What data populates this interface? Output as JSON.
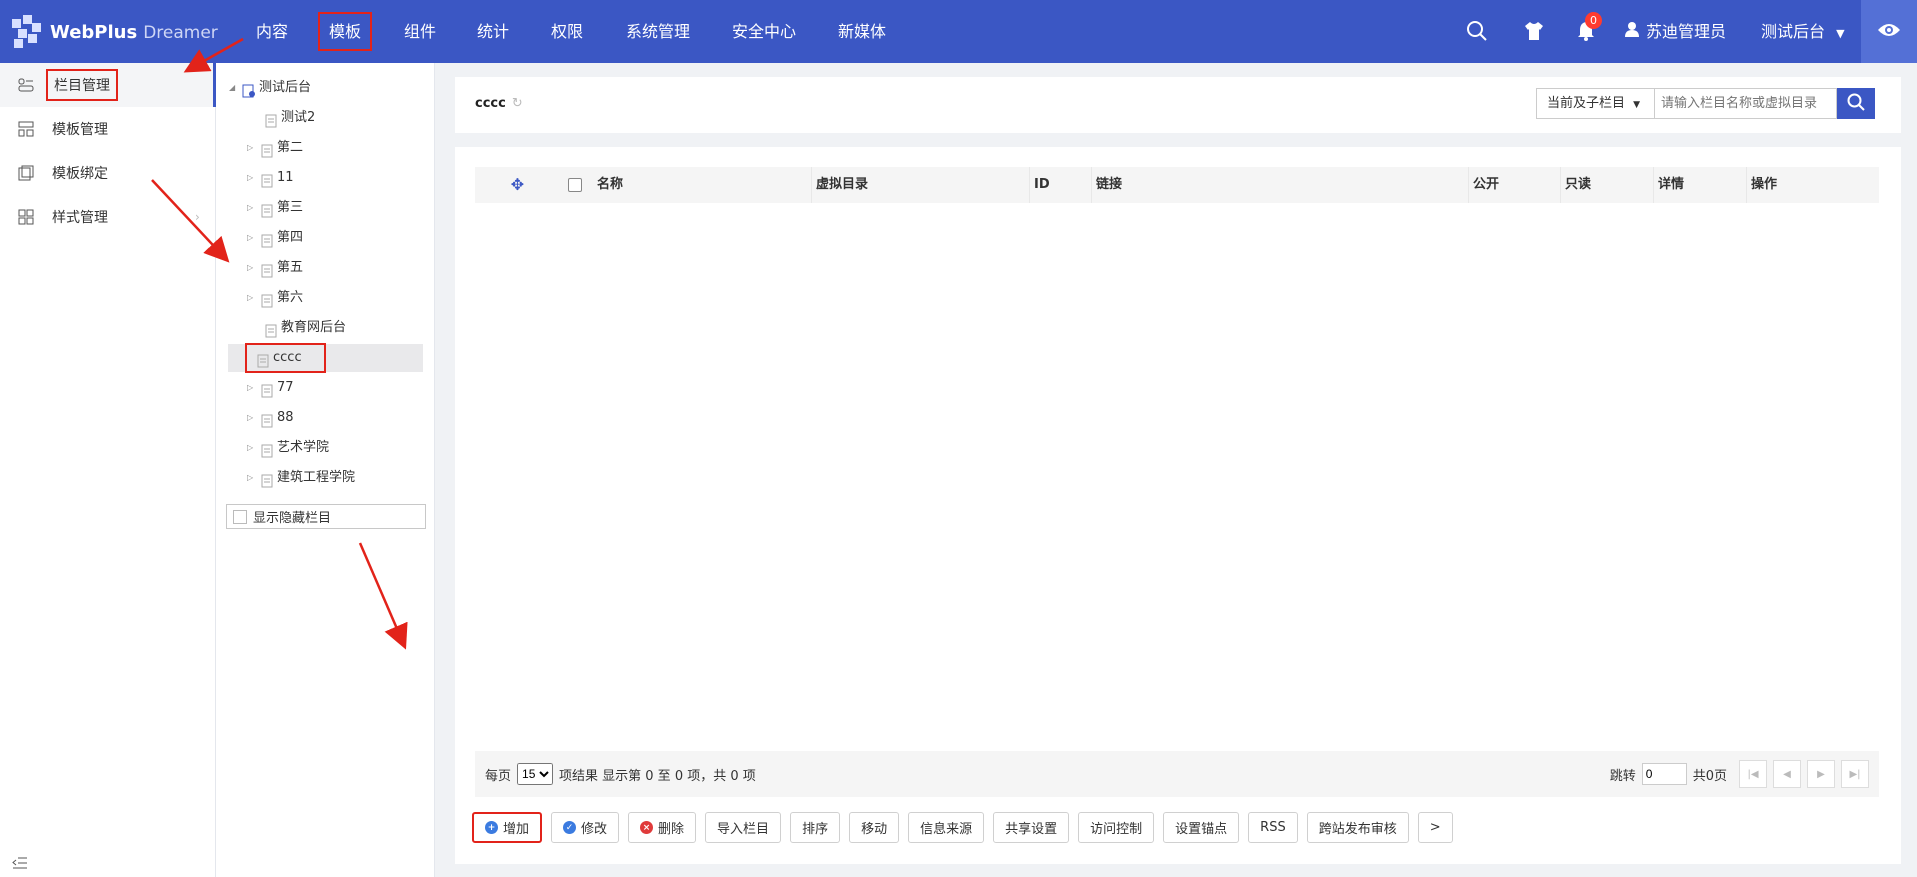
{
  "app": {
    "brand": "WebPlus",
    "brand_sub": "Dreamer"
  },
  "topnav": {
    "items": [
      {
        "label": "内容"
      },
      {
        "label": "模板"
      },
      {
        "label": "组件"
      },
      {
        "label": "统计"
      },
      {
        "label": "权限"
      },
      {
        "label": "系统管理"
      },
      {
        "label": "安全中心"
      },
      {
        "label": "新媒体"
      }
    ],
    "notification_count": "0",
    "user_name": "苏迪管理员",
    "site_name": "测试后台"
  },
  "sidebar": {
    "items": [
      {
        "label": "栏目管理",
        "icon": "column-icon"
      },
      {
        "label": "模板管理",
        "icon": "template-icon"
      },
      {
        "label": "模板绑定",
        "icon": "bind-icon"
      },
      {
        "label": "样式管理",
        "icon": "style-icon"
      }
    ]
  },
  "tree": {
    "root": "测试后台",
    "nodes": [
      {
        "label": "测试2",
        "expandable": false
      },
      {
        "label": "第二",
        "expandable": true
      },
      {
        "label": "11",
        "expandable": true
      },
      {
        "label": "第三",
        "expandable": true
      },
      {
        "label": "第四",
        "expandable": true
      },
      {
        "label": "第五",
        "expandable": true
      },
      {
        "label": "第六",
        "expandable": true
      },
      {
        "label": "教育网后台",
        "expandable": false
      },
      {
        "label": "cccc",
        "expandable": false
      },
      {
        "label": "77",
        "expandable": true
      },
      {
        "label": "88",
        "expandable": true
      },
      {
        "label": "艺术学院",
        "expandable": true
      },
      {
        "label": "建筑工程学院",
        "expandable": true
      }
    ],
    "show_hidden_label": "显示隐藏栏目"
  },
  "main": {
    "title": "cccc",
    "scope_select": "当前及子栏目",
    "search_placeholder": "请输入栏目名称或虚拟目录",
    "columns": [
      "名称",
      "虚拟目录",
      "ID",
      "链接",
      "公开",
      "只读",
      "详情",
      "操作"
    ],
    "pager": {
      "per_page_label": "每页",
      "per_page_value": "15",
      "result_text": "项结果 显示第 0 至 0 项，共 0 项",
      "jump_label": "跳转",
      "jump_value": "0",
      "total_pages": "共0页"
    },
    "toolbar": [
      "增加",
      "修改",
      "删除",
      "导入栏目",
      "排序",
      "移动",
      "信息来源",
      "共享设置",
      "访问控制",
      "设置锚点",
      "RSS",
      "跨站发布审核",
      ">"
    ]
  },
  "colors": {
    "primary": "#3b57c4",
    "highlight": "#e2231a"
  }
}
